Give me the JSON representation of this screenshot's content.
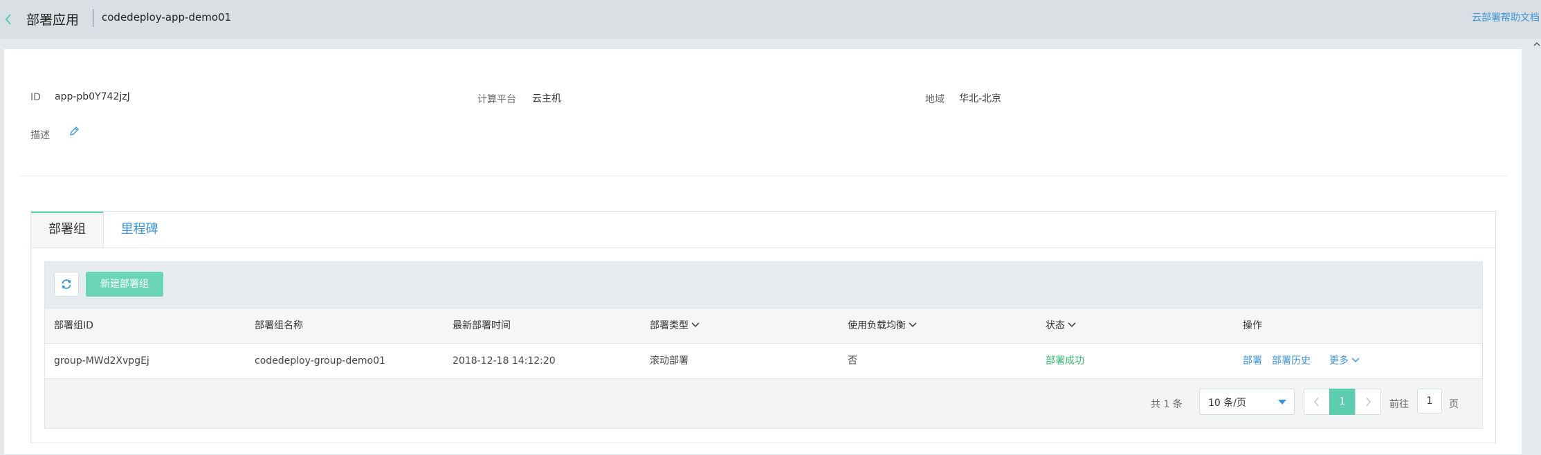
{
  "header": {
    "title": "部署应用",
    "app_name": "codedeploy-app-demo01",
    "help_link": "云部署帮助文档"
  },
  "info": {
    "id_label": "ID",
    "id_value": "app-pb0Y742jzJ",
    "platform_label": "计算平台",
    "platform_value": "云主机",
    "region_label": "地域",
    "region_value": "华北-北京",
    "desc_label": "描述"
  },
  "tabs": [
    {
      "label": "部署组",
      "active": true
    },
    {
      "label": "里程碑",
      "active": false
    }
  ],
  "toolbar": {
    "new_button": "新建部署组"
  },
  "table": {
    "columns": [
      "部署组ID",
      "部署组名称",
      "最新部署时间",
      "部署类型",
      "使用负载均衡",
      "状态",
      "操作"
    ],
    "rows": [
      {
        "id": "group-MWd2XvpgEj",
        "name": "codedeploy-group-demo01",
        "time": "2018-12-18 14:12:20",
        "type": "滚动部署",
        "lb": "否",
        "status": "部署成功",
        "actions": [
          "部署",
          "部署历史",
          "更多"
        ]
      }
    ]
  },
  "pagination": {
    "total": "共 1 条",
    "page_size": "10 条/页",
    "current_page": "1",
    "goto_label": "前往",
    "goto_value": "1",
    "page_unit": "页"
  },
  "colors": {
    "accent": "#5ccdae",
    "link": "#3b95d9",
    "success": "#33b86c"
  }
}
